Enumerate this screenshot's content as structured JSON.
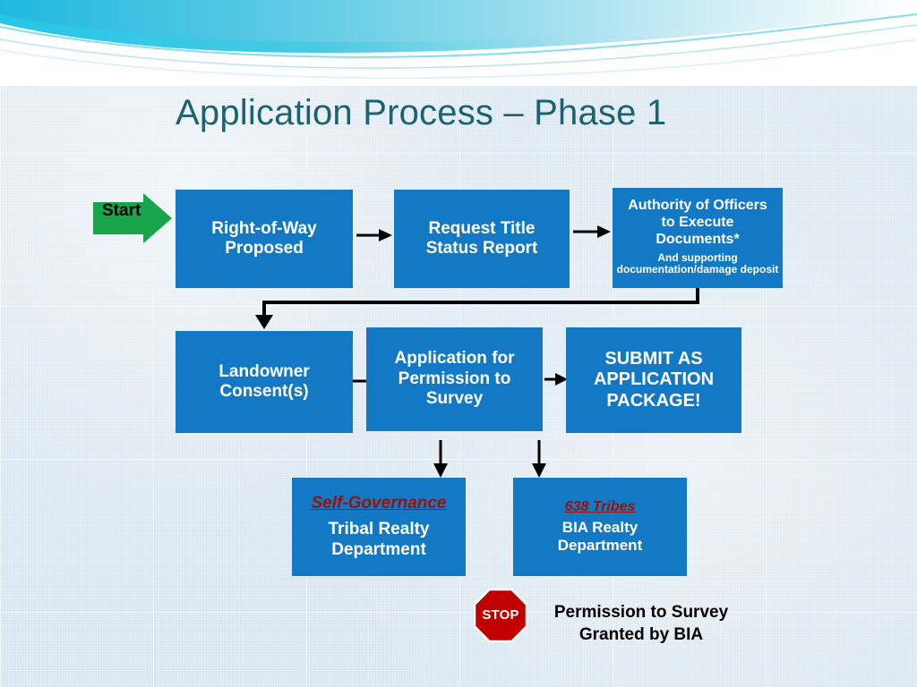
{
  "slide": {
    "title": "Application Process – Phase 1",
    "start_label": "Start",
    "colors": {
      "box_fill": "#1479c4",
      "title_text": "#1d6273",
      "start_arrow": "#19a54a",
      "emphasis_red": "#9c1006",
      "stop_red": "#c00000",
      "background": "#dbe7f1"
    },
    "boxes": {
      "row_of_way": {
        "line1": "Right-of-Way",
        "line2": "Proposed"
      },
      "title_status": {
        "line1": "Request Title",
        "line2": "Status Report"
      },
      "authority": {
        "line1": "Authority of Officers",
        "line2": "to Execute",
        "line3": "Documents*",
        "sub1": "And supporting",
        "sub2": "documentation/damage deposit"
      },
      "landowner": {
        "line1": "Landowner",
        "line2": "Consent(s)"
      },
      "permission_survey": {
        "line1": "Application for",
        "line2": "Permission to",
        "line3": "Survey"
      },
      "submit_package": {
        "line1": "SUBMIT AS",
        "line2": "APPLICATION",
        "line3": "PACKAGE!"
      },
      "self_governance": {
        "heading": "Self-Governance",
        "line1": "Tribal Realty",
        "line2": "Department"
      },
      "tribes_638": {
        "heading": "638 Tribes",
        "line1": "BIA Realty",
        "line2": "Department"
      }
    },
    "stop": {
      "sign_label": "STOP",
      "line1": "Permission to Survey",
      "line2": "Granted by BIA"
    }
  }
}
